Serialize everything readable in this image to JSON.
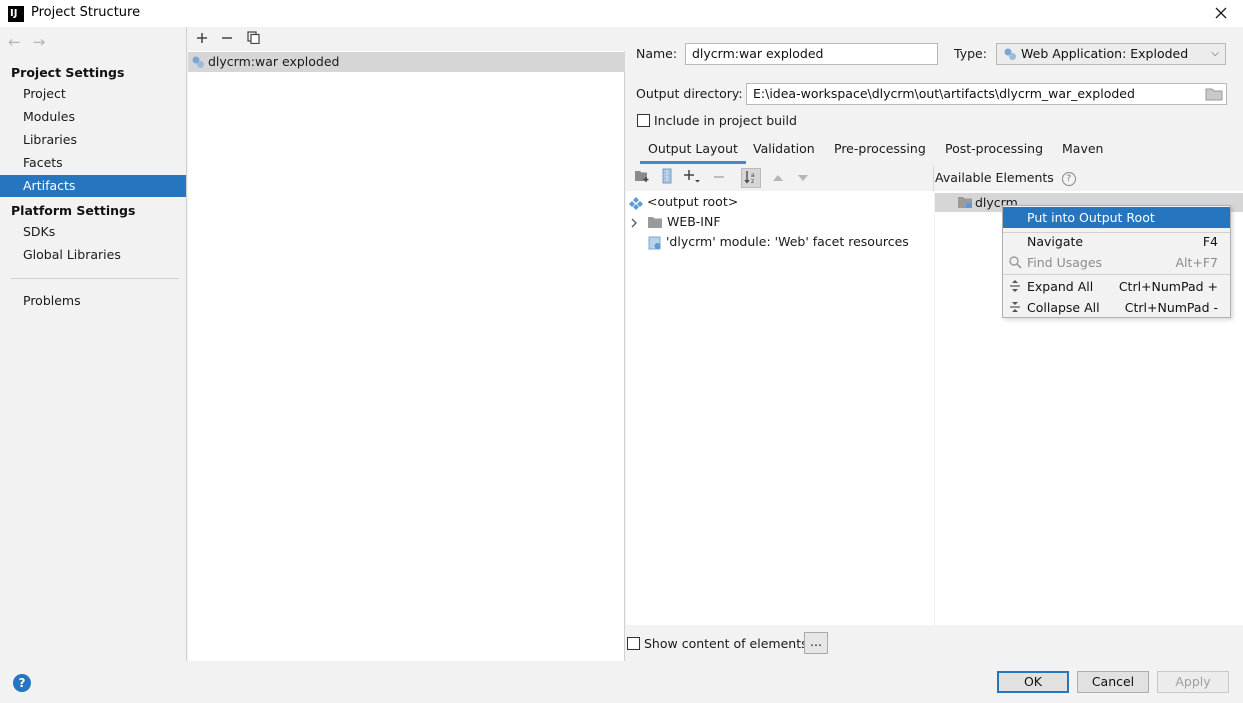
{
  "window": {
    "title": "Project Structure",
    "app_icon_text": "IJ"
  },
  "sidebar": {
    "project_settings_head": "Project Settings",
    "project_items": [
      "Project",
      "Modules",
      "Libraries",
      "Facets",
      "Artifacts"
    ],
    "platform_settings_head": "Platform Settings",
    "platform_items": [
      "SDKs",
      "Global Libraries"
    ],
    "problems": "Problems",
    "selected": "Artifacts"
  },
  "artifact_list": {
    "items": [
      "dlycrm:war exploded"
    ]
  },
  "details": {
    "name_label": "Name:",
    "name_value": "dlycrm:war exploded",
    "type_label": "Type:",
    "type_value": "Web Application: Exploded",
    "output_dir_label": "Output directory:",
    "output_dir_value": "E:\\idea-workspace\\dlycrm\\out\\artifacts\\dlycrm_war_exploded",
    "include_build_label": "Include in project build",
    "tabs": [
      "Output Layout",
      "Validation",
      "Pre-processing",
      "Post-processing",
      "Maven"
    ],
    "active_tab": "Output Layout"
  },
  "output_tree": {
    "root": "<output root>",
    "web_inf": "WEB-INF",
    "facet_resources": "'dlycrm' module: 'Web' facet resources"
  },
  "available": {
    "header": "Available Elements",
    "item": "dlycrm"
  },
  "context_menu": {
    "items": [
      {
        "label": "Put into Output Root",
        "shortcut": ""
      },
      {
        "label": "Navigate",
        "shortcut": "F4"
      },
      {
        "label": "Find Usages",
        "shortcut": "Alt+F7"
      },
      {
        "label": "Expand All",
        "shortcut": "Ctrl+NumPad +"
      },
      {
        "label": "Collapse All",
        "shortcut": "Ctrl+NumPad -"
      }
    ]
  },
  "bottom": {
    "show_content_label": "Show content of elements",
    "more_label": "..."
  },
  "footer": {
    "ok": "OK",
    "cancel": "Cancel",
    "apply": "Apply",
    "help": "?"
  },
  "colors": {
    "accent": "#2675bf",
    "selected_row": "#d6d6d6",
    "background": "#f2f2f2"
  }
}
